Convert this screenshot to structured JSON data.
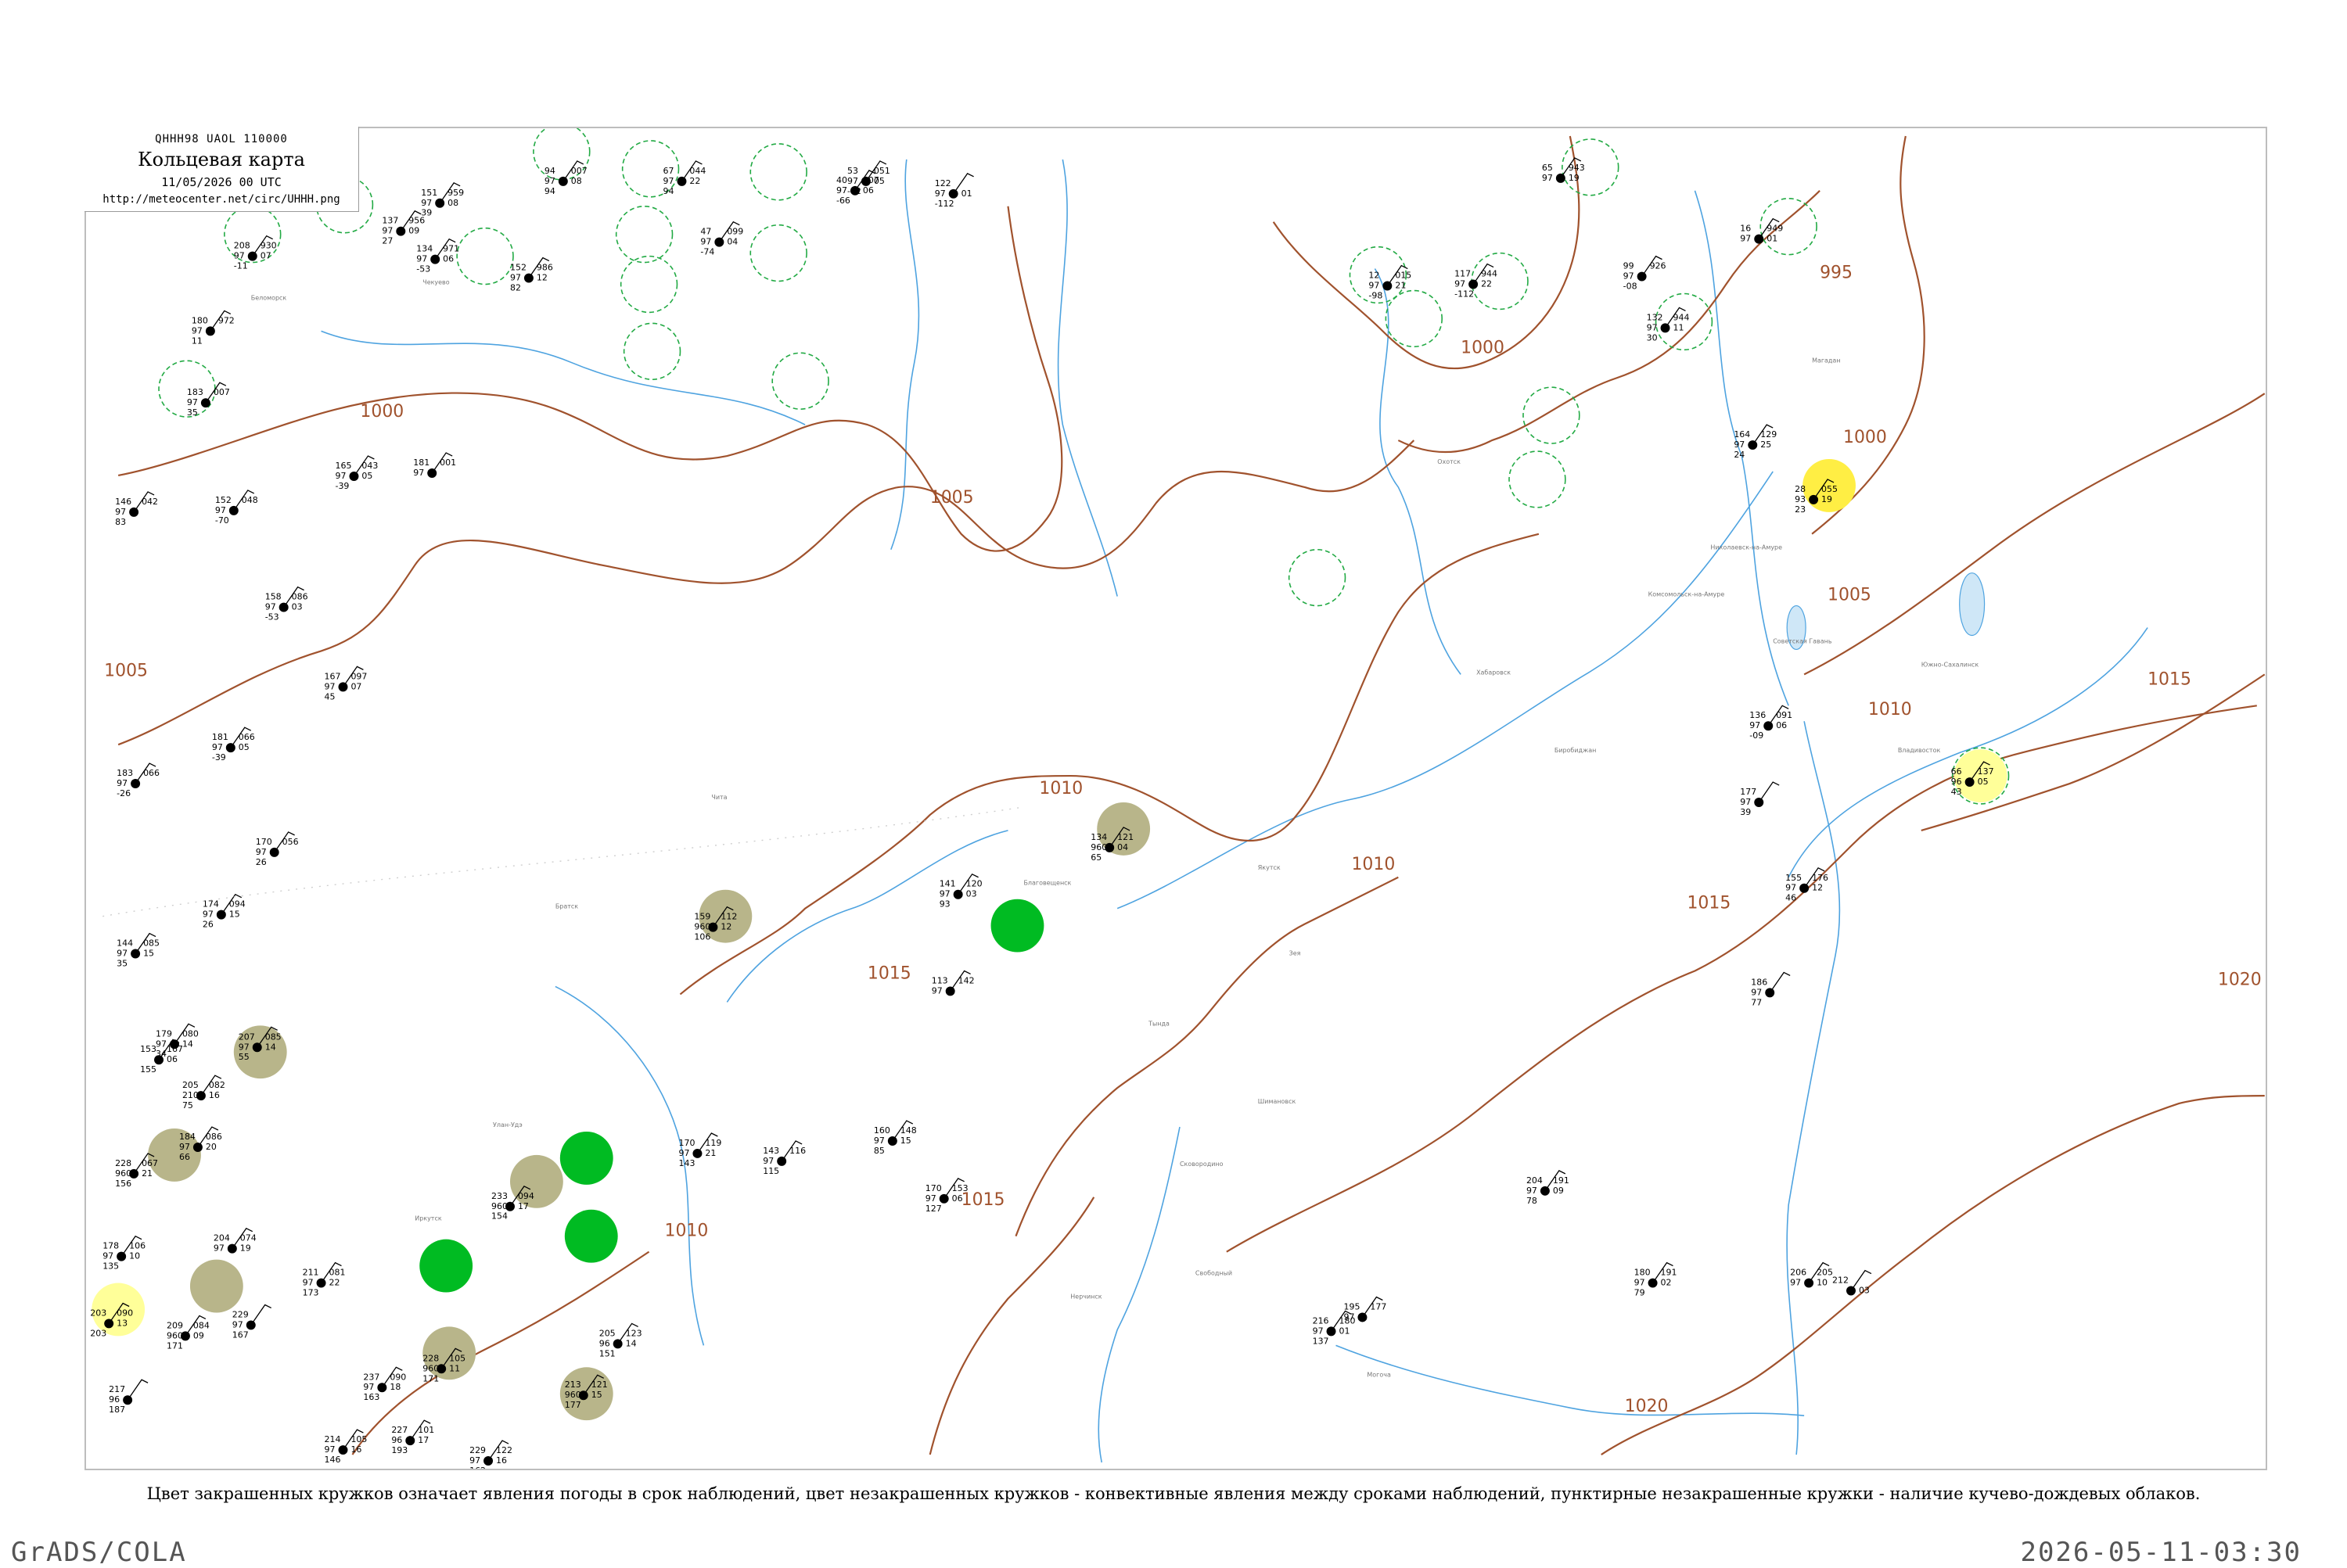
{
  "header": {
    "code": "QHHH98  UAOL  110000",
    "title": "Кольцевая карта",
    "date": "11/05/2026 00 UTC",
    "url": "http://meteocenter.net/circ/UHHH.png"
  },
  "caption": "Цвет закрашенных кружков означает явления погоды в срок наблюдений, цвет незакрашенных кружков - конвективные явления между сроками наблюдений, пунктирные незакрашенные кружки - наличие кучево-дождевых облаков.",
  "footer": {
    "left": "GrADS/COLA",
    "right": "2026-05-11-03:30"
  },
  "colors": {
    "isobar": "#a0522d",
    "river": "#4ea3e0",
    "cb_circle": "#22aa44",
    "rain": "#00bb22",
    "haze": "#b8b58a",
    "fog": "#ffee44",
    "fog_light": "#ffff99"
  },
  "isobar_labels": [
    "1000",
    "1005",
    "1010",
    "1015",
    "1020",
    "995"
  ],
  "stations": [
    {
      "t": "151",
      "td": "97",
      "p": "39",
      "v": "959",
      "n": "08"
    },
    {
      "t": "137",
      "td": "97",
      "p": "27",
      "v": "956",
      "n": "09"
    },
    {
      "t": "94",
      "td": "97",
      "p": "94",
      "v": "007",
      "n": "08"
    },
    {
      "t": "67",
      "td": "97",
      "p": "94",
      "v": "044",
      "n": "22"
    },
    {
      "t": "40",
      "td": "97",
      "p": "-66",
      "v": "107",
      "n": "06"
    },
    {
      "t": "122",
      "td": "97",
      "p": "-112",
      "v": "",
      "n": "01"
    },
    {
      "t": "208",
      "td": "97",
      "p": "-11",
      "v": "930",
      "n": "07"
    },
    {
      "t": "152",
      "td": "97",
      "p": "82",
      "v": "986",
      "n": "12"
    },
    {
      "t": "134",
      "td": "97",
      "p": "-53",
      "v": "971",
      "n": "06"
    },
    {
      "t": "180",
      "td": "97",
      "p": "11",
      "v": "972",
      "n": ""
    },
    {
      "t": "183",
      "td": "97",
      "p": "35",
      "v": "007",
      "n": ""
    },
    {
      "t": "146",
      "td": "97",
      "p": "83",
      "v": "042",
      "n": ""
    },
    {
      "t": "165",
      "td": "97",
      "p": "-39",
      "v": "043",
      "n": "05"
    },
    {
      "t": "152",
      "td": "97",
      "p": "-70",
      "v": "048",
      "n": ""
    },
    {
      "t": "181",
      "td": "97",
      "p": "",
      "v": "001",
      "n": ""
    },
    {
      "t": "158",
      "td": "97",
      "p": "-53",
      "v": "086",
      "n": "03"
    },
    {
      "t": "167",
      "td": "97",
      "p": "45",
      "v": "097",
      "n": "07"
    },
    {
      "t": "181",
      "td": "97",
      "p": "-39",
      "v": "066",
      "n": "05"
    },
    {
      "t": "183",
      "td": "97",
      "p": "-26",
      "v": "066",
      "n": ""
    },
    {
      "t": "170",
      "td": "97",
      "p": "26",
      "v": "056",
      "n": ""
    },
    {
      "t": "174",
      "td": "97",
      "p": "26",
      "v": "094",
      "n": "15"
    },
    {
      "t": "144",
      "td": "97",
      "p": "35",
      "v": "085",
      "n": "15"
    },
    {
      "t": "179",
      "td": "97",
      "p": "34",
      "v": "080",
      "n": "14"
    },
    {
      "t": "207",
      "td": "97",
      "p": "55",
      "v": "085",
      "n": "14"
    },
    {
      "t": "153",
      "td": "",
      "p": "155",
      "v": "167",
      "n": "06"
    },
    {
      "t": "205",
      "td": "2100",
      "p": "75",
      "v": "082",
      "n": "16"
    },
    {
      "t": "228",
      "td": "9600",
      "p": "156",
      "v": "067",
      "n": "21"
    },
    {
      "t": "184",
      "td": "97",
      "p": "66",
      "v": "086",
      "n": "20"
    },
    {
      "t": "178",
      "td": "97",
      "p": "135",
      "v": "106",
      "n": "10"
    },
    {
      "t": "204",
      "td": "97",
      "p": "",
      "v": "074",
      "n": "19"
    },
    {
      "t": "211",
      "td": "97",
      "p": "173",
      "v": "081",
      "n": "22"
    },
    {
      "t": "209",
      "td": "9600",
      "p": "171",
      "v": "084",
      "n": "09"
    },
    {
      "t": "203",
      "td": "",
      "p": "203",
      "v": "090",
      "n": "13"
    },
    {
      "t": "229",
      "td": "97",
      "p": "167",
      "v": "",
      "n": ""
    },
    {
      "t": "217",
      "td": "96",
      "p": "187",
      "v": "",
      "n": ""
    },
    {
      "t": "237",
      "td": "97",
      "p": "163",
      "v": "090",
      "n": "18"
    },
    {
      "t": "214",
      "td": "97",
      "p": "146",
      "v": "105",
      "n": "16"
    },
    {
      "t": "227",
      "td": "96",
      "p": "193",
      "v": "101",
      "n": "17"
    },
    {
      "t": "228",
      "td": "9600",
      "p": "171",
      "v": "105",
      "n": "11"
    },
    {
      "t": "213",
      "td": "9600",
      "p": "177",
      "v": "121",
      "n": "15"
    },
    {
      "t": "229",
      "td": "97",
      "p": "162",
      "v": "122",
      "n": "16"
    },
    {
      "t": "205",
      "td": "96",
      "p": "151",
      "v": "123",
      "n": "14"
    },
    {
      "t": "233",
      "td": "9600",
      "p": "154",
      "v": "094",
      "n": "17"
    },
    {
      "t": "170",
      "td": "97",
      "p": "143",
      "v": "119",
      "n": "21"
    },
    {
      "t": "143",
      "td": "97",
      "p": "115",
      "v": "116",
      "n": ""
    },
    {
      "t": "159",
      "td": "9600",
      "p": "106",
      "v": "112",
      "n": "12"
    },
    {
      "t": "134",
      "td": "9600",
      "p": "65",
      "v": "121",
      "n": "04"
    },
    {
      "t": "141",
      "td": "97",
      "p": "93",
      "v": "120",
      "n": "03"
    },
    {
      "t": "113",
      "td": "97",
      "p": "",
      "v": "142",
      "n": ""
    },
    {
      "t": "160",
      "td": "97",
      "p": "85",
      "v": "148",
      "n": "15"
    },
    {
      "t": "170",
      "td": "97",
      "p": "127",
      "v": "153",
      "n": "06"
    },
    {
      "t": "195",
      "td": "97",
      "p": "",
      "v": "177",
      "n": ""
    },
    {
      "t": "216",
      "td": "97",
      "p": "137",
      "v": "180",
      "n": "01"
    },
    {
      "t": "204",
      "td": "97",
      "p": "78",
      "v": "191",
      "n": "09"
    },
    {
      "t": "180",
      "td": "97",
      "p": "79",
      "v": "191",
      "n": "02"
    },
    {
      "t": "206",
      "td": "97",
      "p": "",
      "v": "205",
      "n": "10"
    },
    {
      "t": "212",
      "td": "",
      "p": "",
      "v": "",
      "n": "03"
    },
    {
      "t": "186",
      "td": "97",
      "p": "77",
      "v": "",
      "n": ""
    },
    {
      "t": "164",
      "td": "97",
      "p": "24",
      "v": "129",
      "n": "25"
    },
    {
      "t": "28",
      "td": "93",
      "p": "23",
      "v": "055",
      "n": "19"
    },
    {
      "t": "66",
      "td": "96",
      "p": "43",
      "v": "137",
      "n": "05"
    },
    {
      "t": "136",
      "td": "97",
      "p": "-09",
      "v": "091",
      "n": "06"
    },
    {
      "t": "177",
      "td": "97",
      "p": "39",
      "v": "",
      "n": ""
    },
    {
      "t": "155",
      "td": "97",
      "p": "46",
      "v": "176",
      "n": "12"
    },
    {
      "t": "99",
      "td": "97",
      "p": "-08",
      "v": "926",
      "n": ""
    },
    {
      "t": "132",
      "td": "97",
      "p": "30",
      "v": "944",
      "n": "11"
    },
    {
      "t": "16",
      "td": "97",
      "p": "",
      "v": "949",
      "n": "01"
    },
    {
      "t": "53",
      "td": "97",
      "p": "-82",
      "v": "051",
      "n": "05"
    },
    {
      "t": "47",
      "td": "97",
      "p": "-74",
      "v": "099",
      "n": "04"
    },
    {
      "t": "12",
      "td": "97",
      "p": "-98",
      "v": "015",
      "n": "21"
    },
    {
      "t": "117",
      "td": "97",
      "p": "-112",
      "v": "944",
      "n": "22"
    },
    {
      "t": "65",
      "td": "97",
      "p": "",
      "v": "943",
      "n": "19"
    }
  ],
  "place_names": [
    "Беломорск",
    "Чекуево",
    "Охотск",
    "Николаевск-на-Амуре",
    "Хабаровск",
    "Владивосток",
    "Благовещенск",
    "Чита",
    "Улан-Удэ",
    "Иркутск",
    "Братск",
    "Якутск",
    "Магадан",
    "Зея",
    "Тында",
    "Сковородино",
    "Свободный",
    "Биробиджан",
    "Комсомольск-на-Амуре",
    "Советская Гавань",
    "Южно-Сахалинск",
    "Нерчинск",
    "Могоча",
    "Шимановск"
  ]
}
